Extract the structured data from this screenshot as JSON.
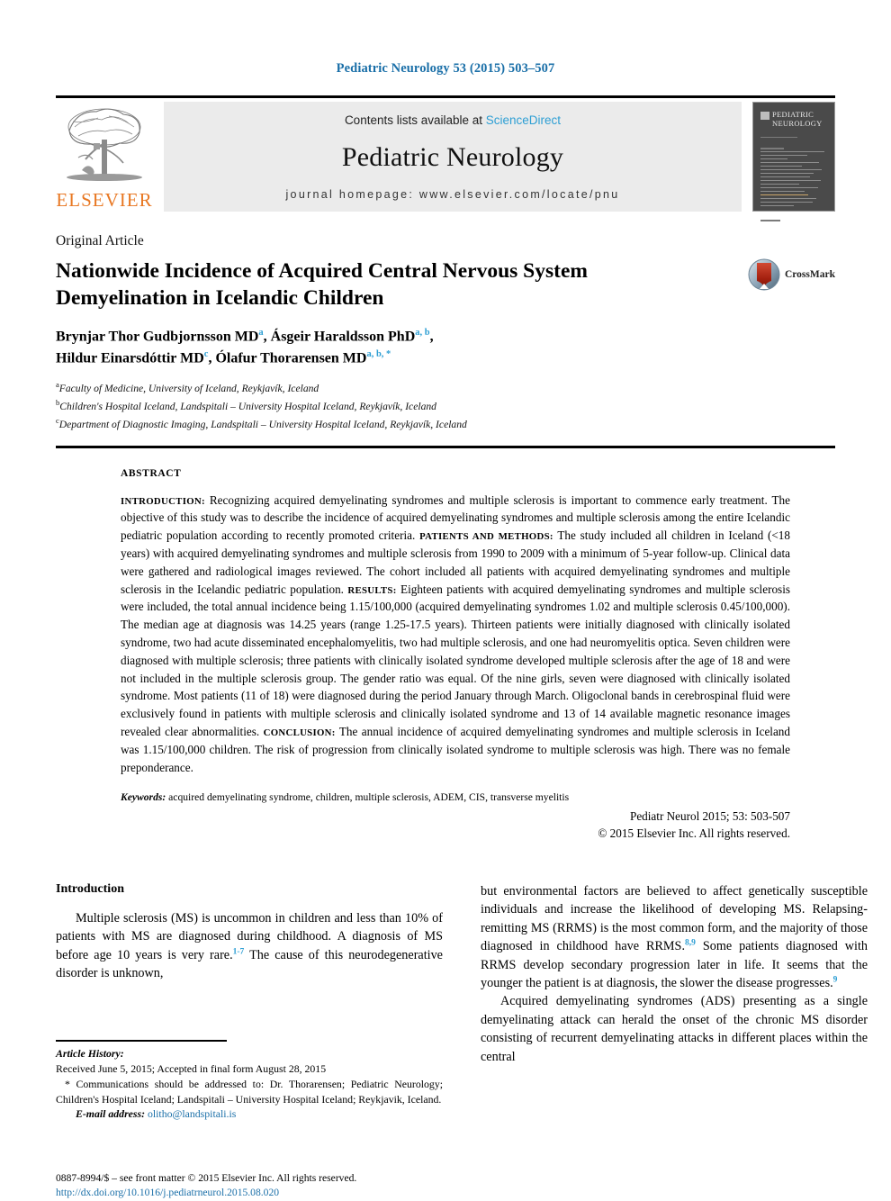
{
  "running_head": "Pediatric Neurology 53 (2015) 503–507",
  "masthead": {
    "contents_prefix": "Contents lists available at ",
    "contents_link": "ScienceDirect",
    "journal_name": "Pediatric Neurology",
    "homepage": "journal homepage: www.elsevier.com/locate/pnu",
    "publisher_logo_word": "ELSEVIER",
    "cover_title_line1": "PEDIATRIC",
    "cover_title_line2": "NEUROLOGY"
  },
  "article": {
    "kicker": "Original Article",
    "title": "Nationwide Incidence of Acquired Central Nervous System Demyelination in Icelandic Children",
    "authors_line1": "Brynjar Thor Gudbjornsson MD",
    "authors_line1_sup1": "a",
    "authors_line1_b": ", Ásgeir Haraldsson PhD",
    "authors_line1_sup2": "a, b",
    "authors_line1_tail": ",",
    "authors_line2": "Hildur Einarsdóttir MD",
    "authors_line2_sup1": "c",
    "authors_line2_b": ", Ólafur Thorarensen MD",
    "authors_line2_sup2": "a, b, *",
    "affiliations": [
      {
        "marker": "a",
        "text": "Faculty of Medicine, University of Iceland, Reykjavík, Iceland"
      },
      {
        "marker": "b",
        "text": "Children's Hospital Iceland, Landspitali – University Hospital Iceland, Reykjavík, Iceland"
      },
      {
        "marker": "c",
        "text": "Department of Diagnostic Imaging, Landspitali – University Hospital Iceland, Reykjavík, Iceland"
      }
    ],
    "crossmark_label": "CrossMark"
  },
  "abstract": {
    "label": "ABSTRACT",
    "sections": [
      {
        "heading": "INTRODUCTION:",
        "text": " Recognizing acquired demyelinating syndromes and multiple sclerosis is important to commence early treatment. The objective of this study was to describe the incidence of acquired demyelinating syndromes and multiple sclerosis among the entire Icelandic pediatric population according to recently promoted criteria. "
      },
      {
        "heading": "PATIENTS AND METHODS:",
        "text": " The study included all children in Iceland (<18 years) with acquired demyelinating syndromes and multiple sclerosis from 1990 to 2009 with a minimum of 5-year follow-up. Clinical data were gathered and radiological images reviewed. The cohort included all patients with acquired demyelinating syndromes and multiple sclerosis in the Icelandic pediatric population. "
      },
      {
        "heading": "RESULTS:",
        "text": " Eighteen patients with acquired demyelinating syndromes and multiple sclerosis were included, the total annual incidence being 1.15/100,000 (acquired demyelinating syndromes 1.02 and multiple sclerosis 0.45/100,000). The median age at diagnosis was 14.25 years (range 1.25-17.5 years). Thirteen patients were initially diagnosed with clinically isolated syndrome, two had acute disseminated encephalomyelitis, two had multiple sclerosis, and one had neuromyelitis optica. Seven children were diagnosed with multiple sclerosis; three patients with clinically isolated syndrome developed multiple sclerosis after the age of 18 and were not included in the multiple sclerosis group. The gender ratio was equal. Of the nine girls, seven were diagnosed with clinically isolated syndrome. Most patients (11 of 18) were diagnosed during the period January through March. Oligoclonal bands in cerebrospinal fluid were exclusively found in patients with multiple sclerosis and clinically isolated syndrome and 13 of 14 available magnetic resonance images revealed clear abnormalities. "
      },
      {
        "heading": "CONCLUSION:",
        "text": " The annual incidence of acquired demyelinating syndromes and multiple sclerosis in Iceland was 1.15/100,000 children. The risk of progression from clinically isolated syndrome to multiple sclerosis was high. There was no female preponderance."
      }
    ],
    "keywords_label": "Keywords:",
    "keywords_text": " acquired demyelinating syndrome, children, multiple sclerosis, ADEM, CIS, transverse myelitis",
    "citation": "Pediatr Neurol 2015; 53: 503-507",
    "copyright": "© 2015 Elsevier Inc. All rights reserved."
  },
  "body": {
    "intro_heading": "Introduction",
    "left_paragraph_1_a": "Multiple sclerosis (MS) is uncommon in children and less than 10% of patients with MS are diagnosed during childhood. A diagnosis of MS before age 10 years is very rare.",
    "left_paragraph_1_ref": "1-7",
    "left_paragraph_1_b": " The cause of this neurodegenerative disorder is unknown,",
    "right_paragraph_1_a": "but environmental factors are believed to affect genetically susceptible individuals and increase the likelihood of developing MS. Relapsing-remitting MS (RRMS) is the most common form, and the majority of those diagnosed in childhood have RRMS.",
    "right_paragraph_1_ref": "8,9",
    "right_paragraph_1_b": " Some patients diagnosed with RRMS develop secondary progression later in life. It seems that the younger the patient is at diagnosis, the slower the disease progresses.",
    "right_paragraph_1_ref2": "9",
    "right_paragraph_2": "Acquired demyelinating syndromes (ADS) presenting as a single demyelinating attack can herald the onset of the chronic MS disorder consisting of recurrent demyelinating attacks in different places within the central"
  },
  "footnotes": {
    "history_label": "Article History:",
    "history_text": "Received June 5, 2015; Accepted in final form August 28, 2015",
    "correspondence": "* Communications should be addressed to: Dr. Thorarensen; Pediatric Neurology; Children's Hospital Iceland; Landspitali – University Hospital Iceland; Reykjavik, Iceland.",
    "email_label": "E-mail address:",
    "email": "olitho@landspitali.is",
    "issn_line": "0887-8994/$ – see front matter © 2015 Elsevier Inc. All rights reserved.",
    "doi_line": "http://dx.doi.org/10.1016/j.pediatrneurol.2015.08.020"
  },
  "colors": {
    "link_blue": "#1a6fa8",
    "science_direct_blue": "#2e9fd4",
    "elsevier_orange": "#E87722",
    "masthead_gray": "#ebebeb",
    "cover_gray": "#4a4a4a"
  }
}
